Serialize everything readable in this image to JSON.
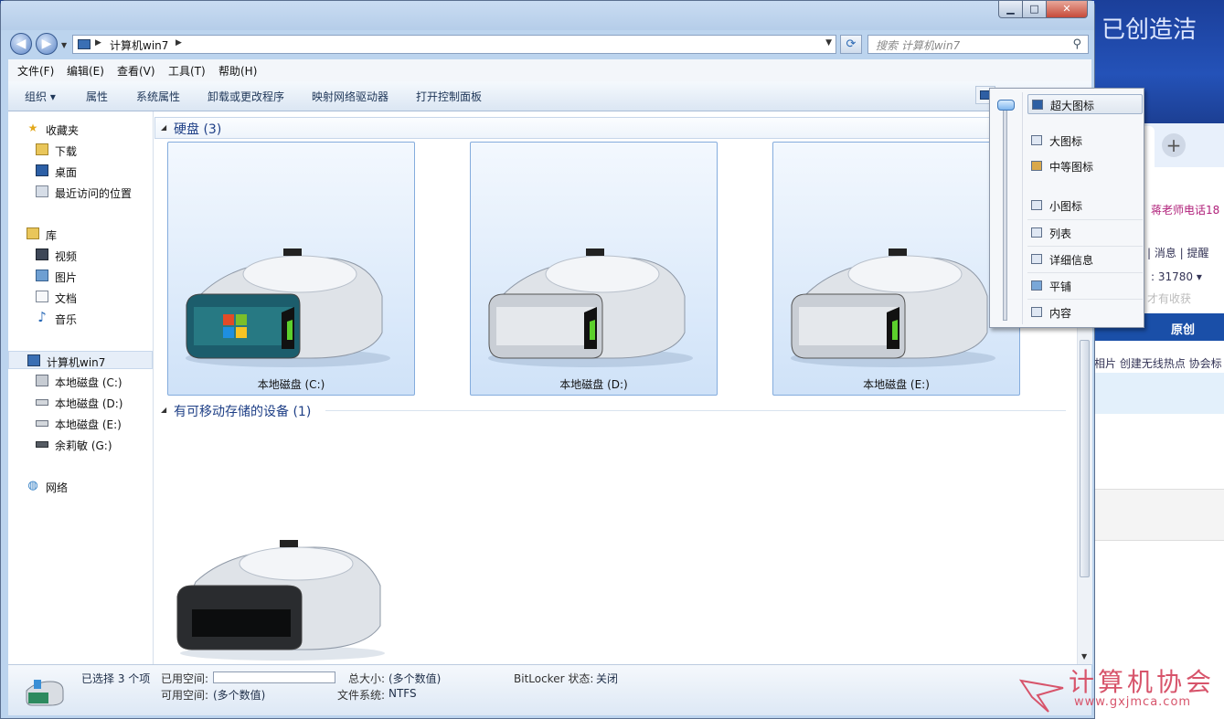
{
  "window": {
    "address_path": "计算机win7",
    "search_placeholder": "搜索 计算机win7"
  },
  "menu": [
    "文件(F)",
    "编辑(E)",
    "查看(V)",
    "工具(T)",
    "帮助(H)"
  ],
  "toolbar": [
    "组织 ▾",
    "属性",
    "系统属性",
    "卸载或更改程序",
    "映射网络驱动器",
    "打开控制面板"
  ],
  "nav": {
    "favorites": "收藏夹",
    "downloads": "下载",
    "desktop": "桌面",
    "recent": "最近访问的位置",
    "libraries": "库",
    "videos": "视频",
    "pictures": "图片",
    "documents": "文档",
    "music": "音乐",
    "computer": "计算机win7",
    "drive_c": "本地磁盘 (C:)",
    "drive_d": "本地磁盘 (D:)",
    "drive_e": "本地磁盘 (E:)",
    "drive_g": "余莉敏 (G:)",
    "network": "网络"
  },
  "groups": {
    "hard_disks": "硬盘 (3)",
    "removable": "有可移动存储的设备 (1)"
  },
  "drives": [
    {
      "label": "本地磁盘 (C:)"
    },
    {
      "label": "本地磁盘 (D:)"
    },
    {
      "label": "本地磁盘 (E:)"
    }
  ],
  "status": {
    "selected": "已选择 3 个项",
    "used_label": "已用空间:",
    "free_label": "可用空间:",
    "free_value": "(多个数值)",
    "total_label": "总大小:",
    "total_value": "(多个数值)",
    "fs_label": "文件系统:",
    "fs_value": "NTFS",
    "bitlocker_label": "BitLocker 状态:",
    "bitlocker_value": "关闭"
  },
  "view_menu": {
    "items": [
      "超大图标",
      "大图标",
      "中等图标",
      "小图标",
      "列表",
      "详细信息",
      "平铺",
      "内容"
    ],
    "selected": "超大图标"
  },
  "background_page": {
    "notice": "！蒋老师电话18",
    "nav": "| 消息 | 提醒",
    "count": ": 31780 ▾",
    "fav": "才有收获",
    "tab_original": "原创",
    "links": "相片  创建无线热点  协会标",
    "banner": "已创造洁"
  },
  "watermark": {
    "title": "计算机协会",
    "url": "www.gxjmca.com"
  },
  "colors": {
    "accent": "#1e3f86",
    "selection": "#cfe2f8",
    "watermark": "#d7546b"
  }
}
